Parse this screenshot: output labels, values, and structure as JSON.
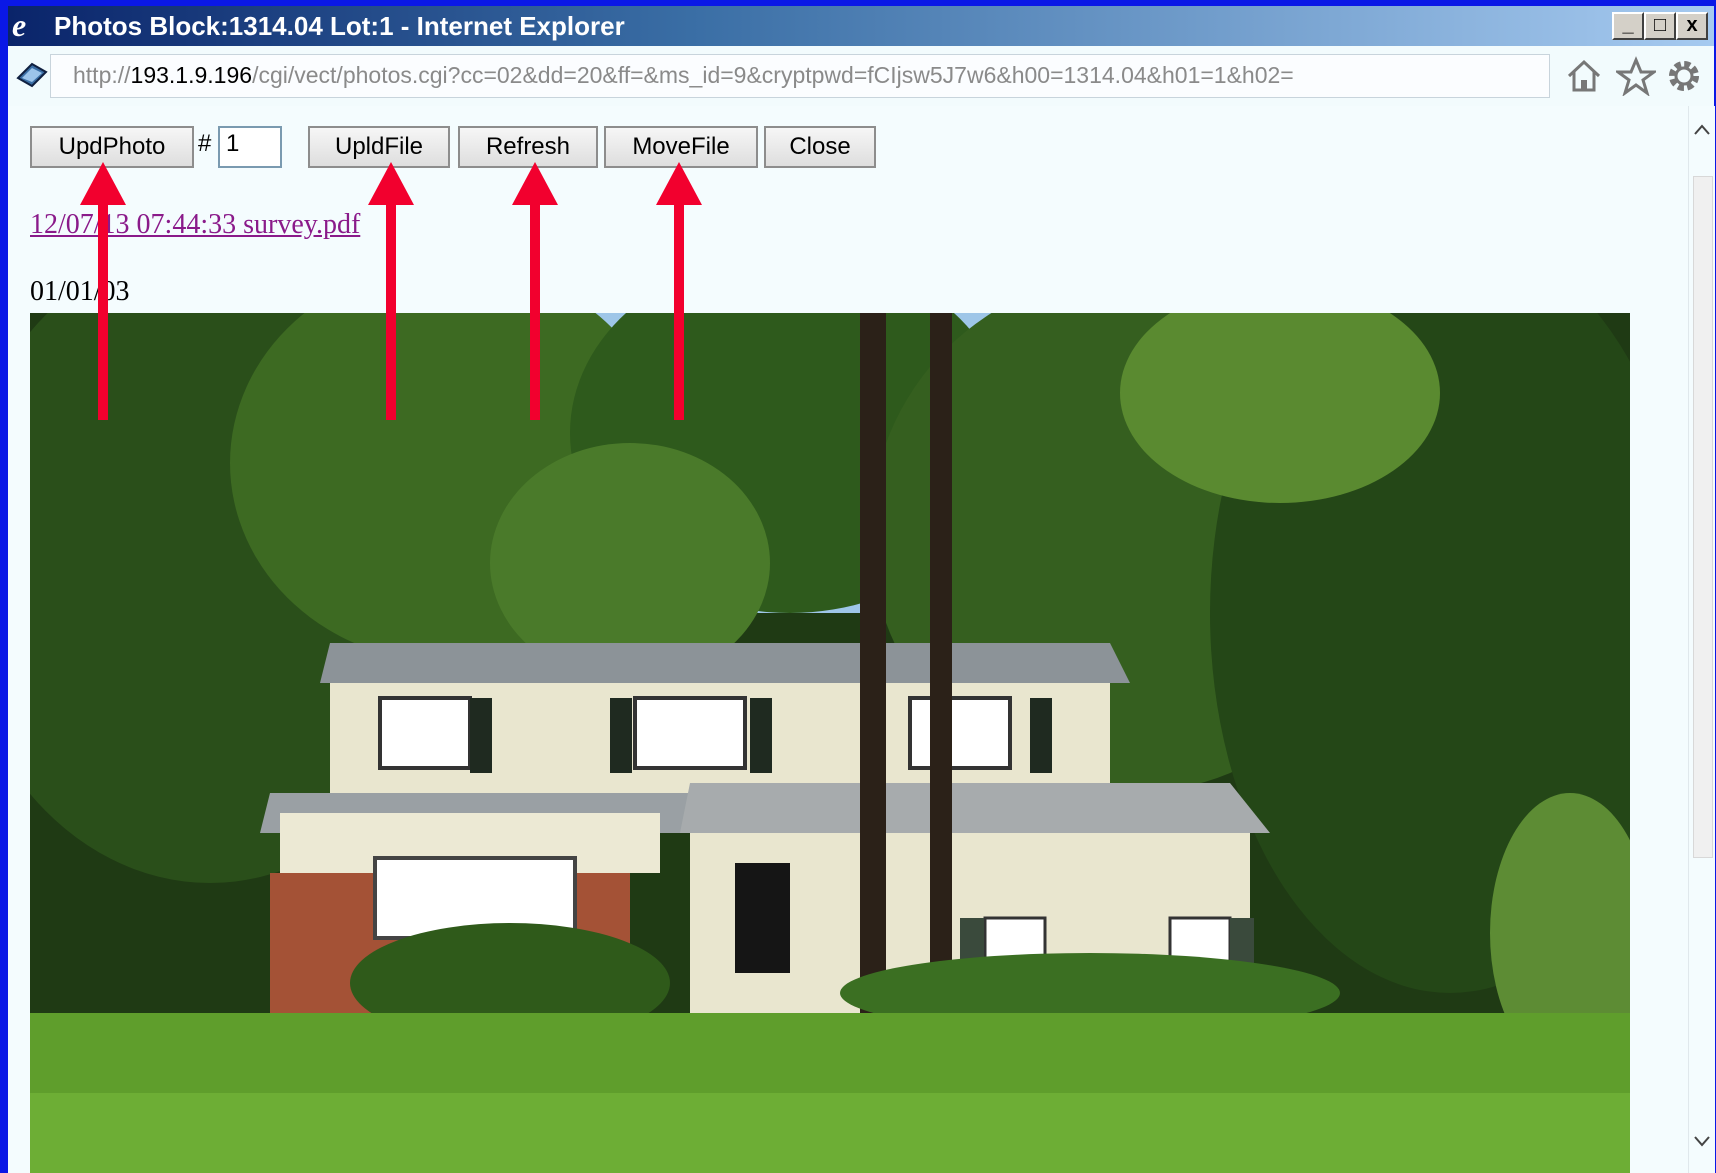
{
  "window": {
    "title": "Photos Block:1314.04 Lot:1 - Internet Explorer",
    "controls": {
      "minimize": "_",
      "maximize": "□",
      "close": "x"
    }
  },
  "address": {
    "prefix": "http://",
    "host": "193.1.9.196",
    "path": "/cgi/vect/photos.cgi?cc=02&dd=20&ff=&ms_id=9&cryptpwd=fCIjsw5J7w6&h00=1314.04&h01=1&h02="
  },
  "toolbar": {
    "upd_photo": "UpdPhoto",
    "hash": "#",
    "photo_number": "1",
    "upld_file": "UpldFile",
    "refresh": "Refresh",
    "move_file": "MoveFile",
    "close": "Close"
  },
  "content": {
    "file_link": "12/07/13 07:44:33 survey.pdf",
    "photo_date": "01/01/03"
  },
  "icons": {
    "home": "home-icon",
    "favorites": "star-icon",
    "tools": "gear-icon",
    "page": "ie-page-icon"
  },
  "colors": {
    "annotation_arrow": "#f2002e",
    "frame_border": "#0a18e6",
    "link_visited": "#8a1a8a"
  }
}
